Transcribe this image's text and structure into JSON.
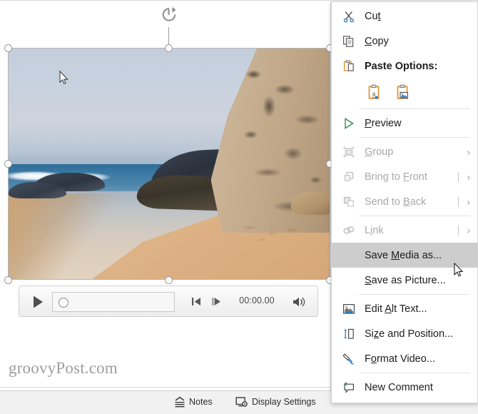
{
  "app": {
    "watermark": "groovyPost.com"
  },
  "media_player": {
    "play_label": "Play",
    "previous_frame_label": "Previous Frame",
    "next_frame_label": "Next Frame",
    "timecode": "00:00.00",
    "volume_label": "Mute/Unmute",
    "progress_value": 0
  },
  "status_bar": {
    "notes_label": "Notes",
    "display_settings_label": "Display Settings"
  },
  "context_menu": {
    "items": [
      {
        "id": "cut",
        "label": "Cut",
        "icon": "scissors-icon",
        "accel_index": 2,
        "disabled": false,
        "submenu": false,
        "bold": false
      },
      {
        "id": "copy",
        "label": "Copy",
        "icon": "copy-icon",
        "accel_index": 0,
        "disabled": false,
        "submenu": false,
        "bold": false
      },
      {
        "id": "paste-options",
        "label": "Paste Options:",
        "icon": "clipboard-icon",
        "accel_index": -1,
        "disabled": false,
        "submenu": false,
        "bold": true
      },
      {
        "id": "preview",
        "label": "Preview",
        "icon": "play-triangle-icon",
        "accel_index": 0,
        "disabled": false,
        "submenu": false,
        "bold": false
      },
      {
        "id": "group",
        "label": "Group",
        "icon": "group-icon",
        "accel_index": 0,
        "disabled": true,
        "submenu": true,
        "bold": false
      },
      {
        "id": "bring-to-front",
        "label": "Bring to Front",
        "icon": "bring-front-icon",
        "accel_index": 9,
        "disabled": true,
        "submenu": true,
        "bold": false
      },
      {
        "id": "send-to-back",
        "label": "Send to Back",
        "icon": "send-back-icon",
        "accel_index": 8,
        "disabled": true,
        "submenu": true,
        "bold": false
      },
      {
        "id": "link",
        "label": "Link",
        "icon": "link-icon",
        "accel_index": 1,
        "disabled": true,
        "submenu": true,
        "bold": false
      },
      {
        "id": "save-media-as",
        "label": "Save Media as...",
        "icon": "none",
        "accel_index": 5,
        "disabled": false,
        "submenu": false,
        "bold": false
      },
      {
        "id": "save-as-picture",
        "label": "Save as Picture...",
        "icon": "none",
        "accel_index": 0,
        "disabled": false,
        "submenu": false,
        "bold": false
      },
      {
        "id": "edit-alt-text",
        "label": "Edit Alt Text...",
        "icon": "alt-text-icon",
        "accel_index": 5,
        "disabled": false,
        "submenu": false,
        "bold": false
      },
      {
        "id": "size-and-position",
        "label": "Size and Position...",
        "icon": "size-position-icon",
        "accel_index": 2,
        "disabled": false,
        "submenu": false,
        "bold": false
      },
      {
        "id": "format-video",
        "label": "Format Video...",
        "icon": "format-video-icon",
        "accel_index": 1,
        "disabled": false,
        "submenu": false,
        "bold": false
      },
      {
        "id": "new-comment",
        "label": "New Comment",
        "icon": "new-comment-icon",
        "accel_index": -1,
        "disabled": false,
        "submenu": false,
        "bold": false
      }
    ],
    "paste_options": [
      {
        "id": "keep-text-only",
        "label": "Keep Text Only",
        "icon": "paste-text-icon"
      },
      {
        "id": "picture",
        "label": "Picture",
        "icon": "paste-picture-icon"
      }
    ],
    "selected_item_id": "save-media-as"
  },
  "colors": {
    "accent_orange": "#e08a26",
    "accent_blue": "#2f7fc4",
    "accent_green": "#2e8b4f",
    "menu_bg": "#ffffff",
    "menu_selected_bg": "#cdcdcd",
    "selection_handle_border": "#9a9a9a"
  },
  "media_object": {
    "alt": "beach scene with rocks, ocean surf and sand",
    "selected": true,
    "handles": [
      "top-left",
      "top-center",
      "top-right",
      "middle-left",
      "middle-right",
      "bottom-left",
      "bottom-center",
      "bottom-right"
    ],
    "rotation_handle": "rotate-handle"
  }
}
